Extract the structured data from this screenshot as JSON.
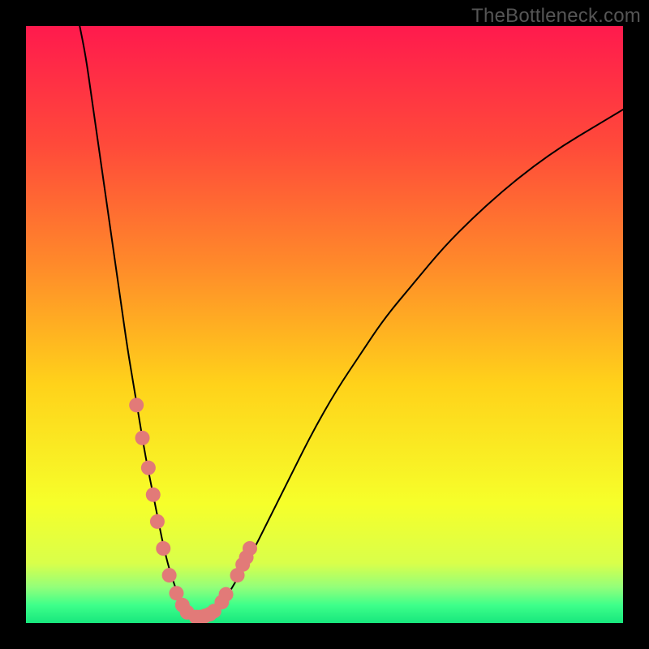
{
  "watermark": "TheBottleneck.com",
  "chart_data": {
    "type": "line",
    "title": "",
    "xlabel": "",
    "ylabel": "",
    "xlim": [
      0,
      100
    ],
    "ylim": [
      0,
      100
    ],
    "grid": false,
    "legend": false,
    "background_gradient": {
      "stops": [
        {
          "offset": 0.0,
          "color": "#ff1a4d"
        },
        {
          "offset": 0.2,
          "color": "#ff4a3a"
        },
        {
          "offset": 0.4,
          "color": "#ff8a2a"
        },
        {
          "offset": 0.6,
          "color": "#ffd21a"
        },
        {
          "offset": 0.8,
          "color": "#f6ff2a"
        },
        {
          "offset": 0.9,
          "color": "#d9ff4a"
        },
        {
          "offset": 0.94,
          "color": "#93ff7a"
        },
        {
          "offset": 0.97,
          "color": "#3eff8a"
        },
        {
          "offset": 1.0,
          "color": "#17e77d"
        }
      ]
    },
    "series": [
      {
        "name": "bottleneck-curve",
        "type": "line",
        "color": "#000000",
        "width": 2,
        "x": [
          9,
          10,
          11,
          12,
          13,
          14,
          15,
          16,
          17,
          18,
          19,
          20,
          21,
          22,
          23,
          24,
          25,
          26,
          27,
          28,
          29,
          30,
          32,
          34,
          36,
          38,
          40,
          44,
          48,
          52,
          56,
          60,
          65,
          70,
          75,
          80,
          85,
          90,
          95,
          100
        ],
        "y": [
          100,
          95,
          88,
          81,
          74,
          67,
          60,
          53,
          46,
          40,
          34,
          28,
          23,
          18,
          13,
          9,
          6,
          3.5,
          2,
          1.2,
          1,
          1.2,
          2.5,
          5,
          8.5,
          12,
          16,
          24,
          32,
          39,
          45,
          51,
          57,
          63,
          68,
          72.5,
          76.5,
          80,
          83,
          86
        ]
      },
      {
        "name": "highlight-markers",
        "type": "scatter",
        "color": "#e27a78",
        "radius": 9,
        "x": [
          18.5,
          19.5,
          20.5,
          21.3,
          22.0,
          23.0,
          24.0,
          25.2,
          26.2,
          27.0,
          28.5,
          29.2,
          30.0,
          30.8,
          31.5,
          32.8,
          33.5,
          35.4,
          36.3,
          36.9,
          37.5
        ],
        "y": [
          36.5,
          31.0,
          26.0,
          21.5,
          17.0,
          12.5,
          8.0,
          5.0,
          3.0,
          1.8,
          1.0,
          1.0,
          1.2,
          1.5,
          2.0,
          3.5,
          4.8,
          8.0,
          9.8,
          11.0,
          12.5
        ]
      }
    ]
  }
}
